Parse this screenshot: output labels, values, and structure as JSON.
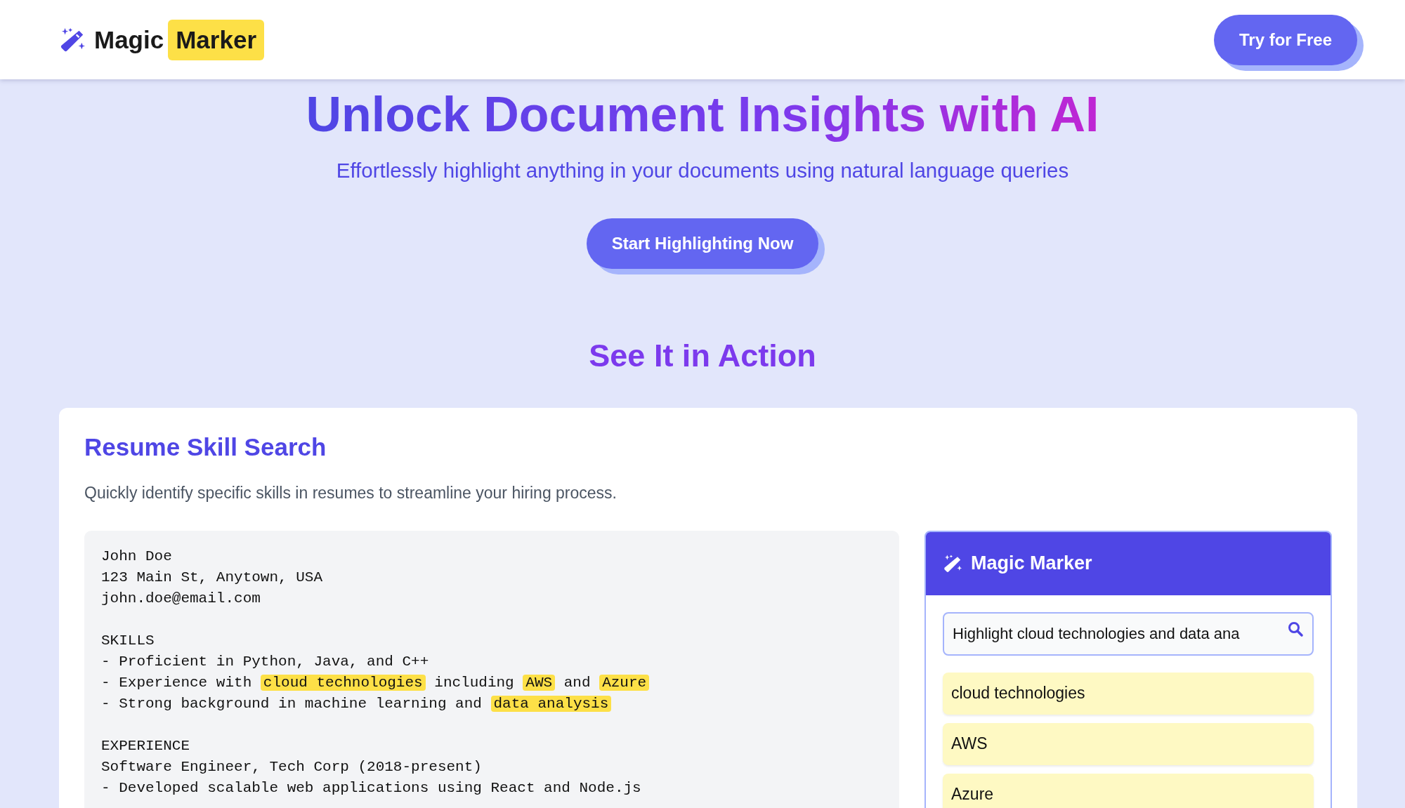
{
  "header": {
    "logo": {
      "word": "Magic",
      "highlighted_word": "Marker"
    },
    "cta": "Try for Free"
  },
  "hero": {
    "title": "Unlock Document Insights with AI",
    "subtitle": "Effortlessly highlight anything in your documents using natural language queries",
    "button": "Start Highlighting Now"
  },
  "section_title": "See It in Action",
  "demo": {
    "title": "Resume Skill Search",
    "description": "Quickly identify specific skills in resumes to streamline your hiring process.",
    "document": [
      {
        "lines": [
          [
            {
              "text": "John Doe",
              "highlighted": false
            }
          ],
          [
            {
              "text": "123 Main St, Anytown, USA",
              "highlighted": false
            }
          ],
          [
            {
              "text": "john.doe@email.com",
              "highlighted": false
            }
          ]
        ]
      },
      {
        "lines": [
          [
            {
              "text": "SKILLS",
              "highlighted": false
            }
          ],
          [
            {
              "text": "- Proficient in Python, Java, and C++",
              "highlighted": false
            }
          ],
          [
            {
              "text": "- Experience with ",
              "highlighted": false
            },
            {
              "text": "cloud technologies",
              "highlighted": true
            },
            {
              "text": " including ",
              "highlighted": false
            },
            {
              "text": "AWS",
              "highlighted": true
            },
            {
              "text": " and ",
              "highlighted": false
            },
            {
              "text": "Azure",
              "highlighted": true
            }
          ],
          [
            {
              "text": "- Strong background in machine learning and ",
              "highlighted": false
            },
            {
              "text": "data analysis",
              "highlighted": true
            }
          ]
        ]
      },
      {
        "lines": [
          [
            {
              "text": "EXPERIENCE",
              "highlighted": false
            }
          ],
          [
            {
              "text": "Software Engineer, Tech Corp (2018-present)",
              "highlighted": false
            }
          ],
          [
            {
              "text": "- Developed scalable web applications using React and Node.js",
              "highlighted": false
            }
          ]
        ]
      }
    ],
    "panel": {
      "title": "Magic Marker",
      "query": "Highlight cloud technologies and data ana",
      "results": [
        "cloud technologies",
        "AWS",
        "Azure"
      ]
    }
  }
}
